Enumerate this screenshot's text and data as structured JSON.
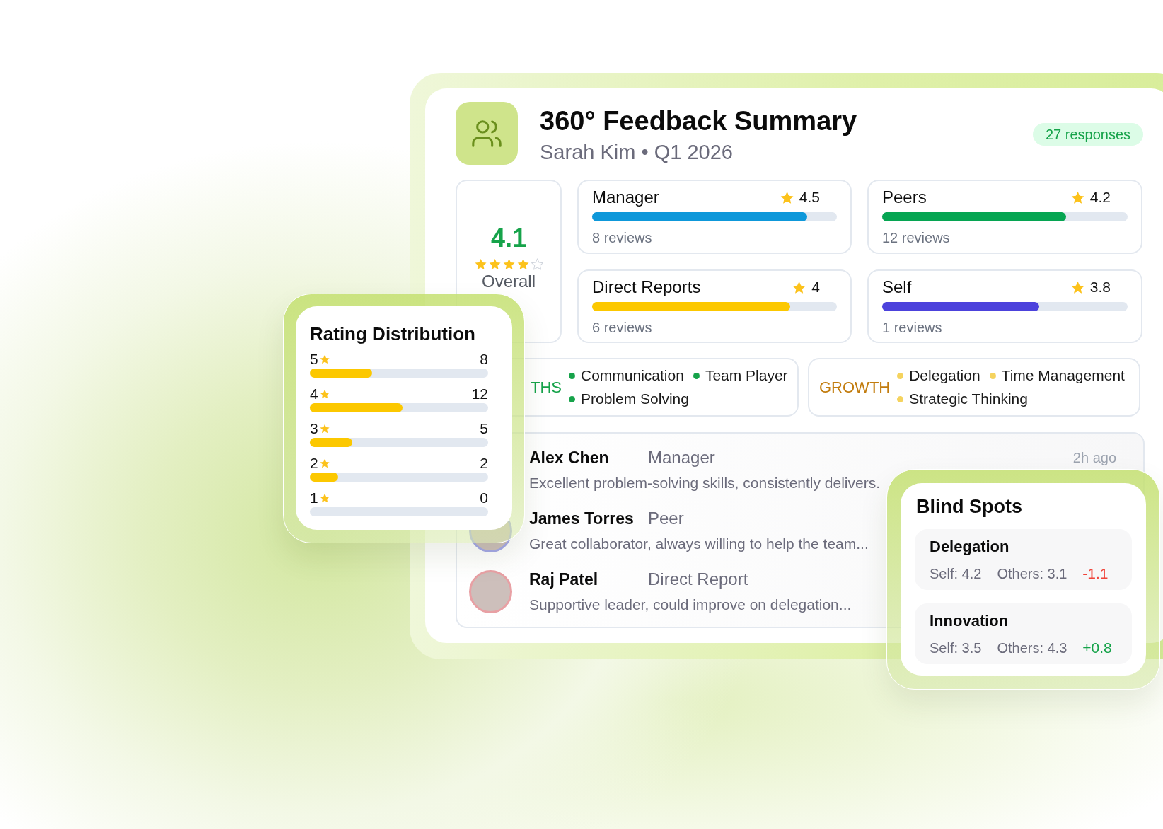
{
  "header": {
    "title": "360° Feedback Summary",
    "subtitle": "Sarah Kim • Q1 2026",
    "badge": "27 responses"
  },
  "overall": {
    "score": "4.1",
    "stars": 4,
    "label": "Overall"
  },
  "categories": [
    {
      "name": "Manager",
      "rating": "4.5",
      "level": 0.88,
      "color": "#0e98da",
      "reviews": "8 reviews"
    },
    {
      "name": "Peers",
      "rating": "4.2",
      "level": 0.75,
      "color": "#06a552",
      "reviews": "12 reviews"
    },
    {
      "name": "Direct Reports",
      "rating": "4",
      "level": 0.81,
      "color": "#fcc800",
      "reviews": "6 reviews"
    },
    {
      "name": "Self",
      "rating": "3.8",
      "level": 0.64,
      "color": "#4c42dc",
      "reviews": "1 reviews"
    }
  ],
  "themes": [
    {
      "kind": "strength",
      "label": "THS",
      "items": [
        "Communication",
        "Team Player",
        "Problem Solving"
      ]
    },
    {
      "kind": "growth",
      "label": "GROWTH",
      "items": [
        "Delegation",
        "Time Management",
        "Strategic Thinking"
      ]
    }
  ],
  "feedback": [
    {
      "name": "Alex Chen",
      "role": "Manager",
      "comment": "Excellent problem-solving skills, consistently delivers.",
      "time": "2h ago"
    },
    {
      "name": "James Torres",
      "role": "Peer",
      "comment": "Great collaborator, always willing to help the team...",
      "color": "#a5a8e8"
    },
    {
      "name": "Raj Patel",
      "role": "Direct Report",
      "comment": "Supportive leader, could improve on delegation...",
      "color": "#e8a0a4"
    }
  ],
  "rating_distribution": {
    "title": "Rating Distribution",
    "rows": [
      {
        "rating": "5",
        "count": "8",
        "level": 0.35
      },
      {
        "rating": "4",
        "count": "12",
        "level": 0.52
      },
      {
        "rating": "3",
        "count": "5",
        "level": 0.24
      },
      {
        "rating": "2",
        "count": "2",
        "level": 0.16
      },
      {
        "rating": "1",
        "count": "0"
      }
    ]
  },
  "blind_spots": {
    "title": "Blind Spots",
    "items": [
      {
        "name": "Delegation",
        "self": "Self: 4.2",
        "others": "Others: 3.1",
        "gap": "-1.1",
        "kind": "negative"
      },
      {
        "name": "Innovation",
        "self": "Self: 3.5",
        "others": "Others: 4.3",
        "gap": "+0.8",
        "kind": "positive"
      }
    ]
  }
}
